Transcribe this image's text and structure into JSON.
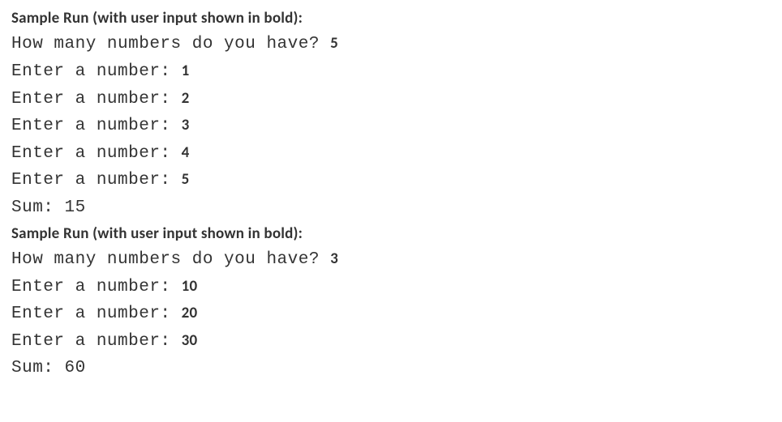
{
  "heading": "Sample Run (with user input shown in bold):",
  "run1": {
    "prompt_count": "How many numbers do you have? ",
    "count_input": "5",
    "enter_prompt": "Enter a number: ",
    "inputs": [
      "1",
      "2",
      "3",
      "4",
      "5"
    ],
    "sum_label": "Sum: ",
    "sum_value": "15"
  },
  "run2": {
    "prompt_count": "How many numbers do you have? ",
    "count_input": "3",
    "enter_prompt": "Enter a number: ",
    "inputs": [
      "10",
      "20",
      "30"
    ],
    "sum_label": "Sum: ",
    "sum_value": "60"
  }
}
